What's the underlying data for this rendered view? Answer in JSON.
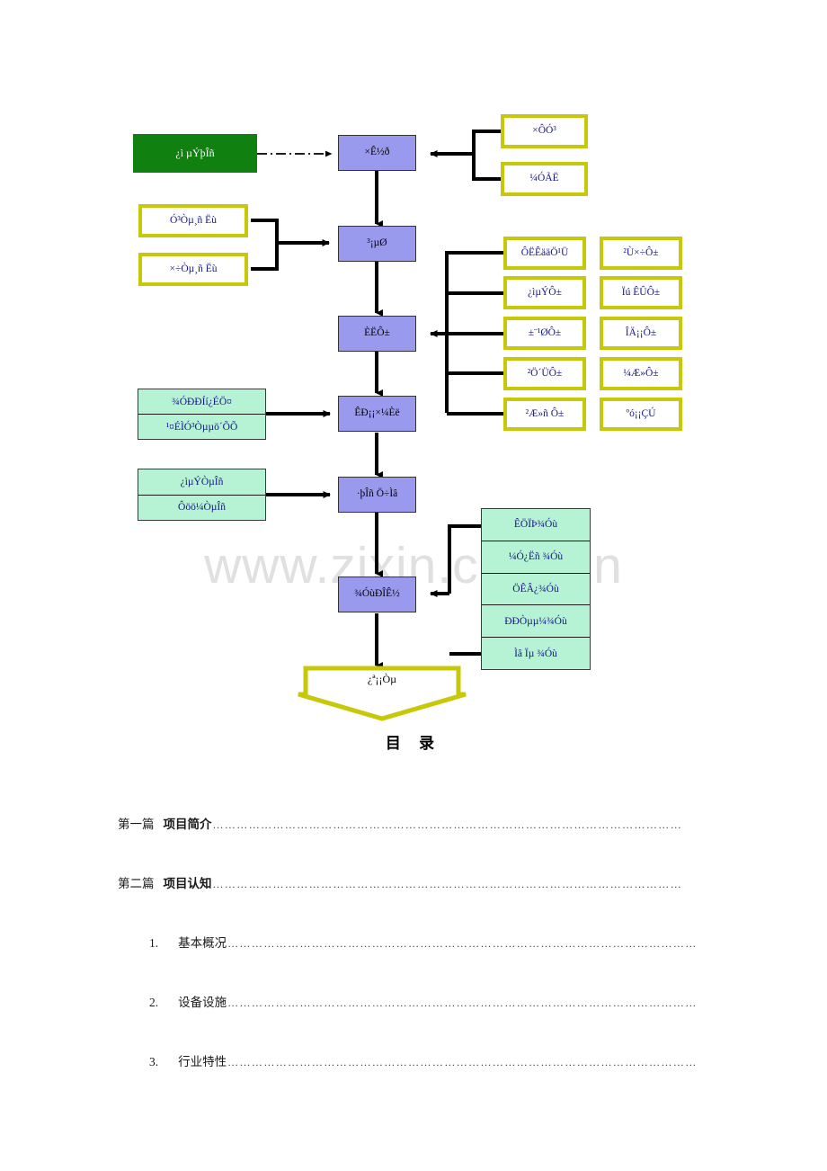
{
  "watermark": {
    "text": "www.zixin.com.cn"
  },
  "diagram": {
    "source_box": {
      "label": "¿ì µÝþÎñ"
    },
    "spine": [
      {
        "label": "×Ê½ð"
      },
      {
        "label": "³¡µØ"
      },
      {
        "label": "ÈËÔ±"
      },
      {
        "label": "ÊÐ¡¡×¼Èë"
      },
      {
        "label": "·þÎñ Ö÷Ìâ"
      },
      {
        "label": "¾­ÓùÐÎÊ½"
      }
    ],
    "top_right_inputs": [
      {
        "label": "×ÔÓ³"
      },
      {
        "label": "¼ÓÃË"
      }
    ],
    "left_site_inputs": [
      {
        "label": "Ó³Òµ¸ñ Ëù"
      },
      {
        "label": "×÷Òµ¸ñ Ëù"
      }
    ],
    "staff_grid": [
      {
        "left": "ÔËÊääÖ¹Ü",
        "right": "²Ù×÷Ô±"
      },
      {
        "left": "¿ìµÝÔ±",
        "right": "Ïú ÊÛÔ±"
      },
      {
        "left": "±¨¹ØÔ±",
        "right": "ÎÄ¡¡Ô±"
      },
      {
        "left": "²Ö´ÜÔ±",
        "right": "¼Æ»Ô±"
      },
      {
        "left": "²Æ»ñ Ô±",
        "right": "ºó¡¡ÇÚ"
      }
    ],
    "market_access": [
      {
        "label": "¾ÓÐÐÍí¿ÉÖ¤"
      },
      {
        "label": "¹¤ÉÌÓ³Òµµö´ÕÕ"
      }
    ],
    "service_theme": [
      {
        "label": "¿ìµÝÒµÎñ"
      },
      {
        "label": "Ôöö¼ÒµÎñ"
      }
    ],
    "operation_modes": [
      {
        "label": "ÊÖÏÞ¾­Óù"
      },
      {
        "label": "¼Ó¿Ëñ ¾­Óù"
      },
      {
        "label": "ÖÊÂ¿¾­Óù"
      },
      {
        "label": "ÐÐÒµµ¼¾­Óù"
      },
      {
        "label": "Ìâ Ïµ ¾­Óù"
      }
    ],
    "end_node": {
      "label": "¿ª¡¡Òµ"
    }
  },
  "toc": {
    "title": "目  录",
    "dots": "………………………………………………………………………………………………………",
    "entries": [
      {
        "num": "第一篇",
        "title": "项目简介",
        "level": 1
      },
      {
        "num": "第二篇",
        "title": "项目认知",
        "level": 1
      },
      {
        "num": "1.",
        "title": "基本概况",
        "level": 2
      },
      {
        "num": "2.",
        "title": "设备设施",
        "level": 2
      },
      {
        "num": "3.",
        "title": "行业特性",
        "level": 2
      }
    ]
  }
}
